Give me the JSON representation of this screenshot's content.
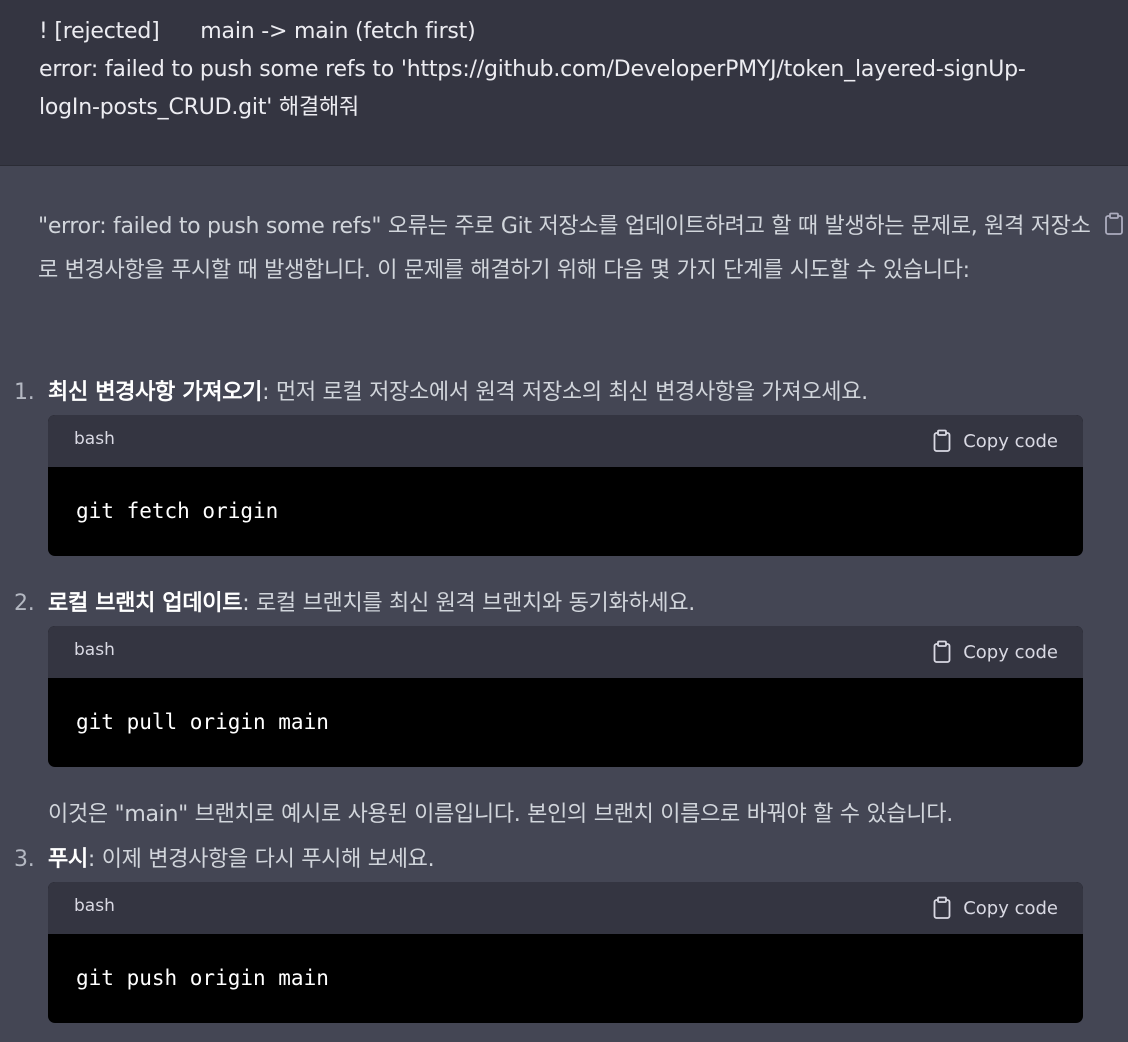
{
  "user": {
    "message": "! [rejected]      main -> main (fetch first)\nerror: failed to push some refs to 'https://github.com/DeveloperPMYJ/token_layered-signUp-\nlogIn-posts_CRUD.git' 해결해줘"
  },
  "assistant": {
    "intro": "\"error: failed to push some refs\" 오류는 주로 Git 저장소를 업데이트하려고 할 때 발생하는 문제로, 원격 저장소로 변경사항을 푸시할 때 발생합니다. 이 문제를 해결하기 위해 다음 몇 가지 단계를 시도할 수 있습니다:",
    "copy_icon": "clipboard-icon",
    "steps": [
      {
        "number": "1.",
        "title": "최신 변경사항 가져오기",
        "text": ": 먼저 로컬 저장소에서 원격 저장소의 최신 변경사항을 가져오세요.",
        "code_lang": "bash",
        "copy_label": "Copy code",
        "code": "git fetch origin"
      },
      {
        "number": "2.",
        "title": "로컬 브랜치 업데이트",
        "text": ": 로컬 브랜치를 최신 원격 브랜치와 동기화하세요.",
        "code_lang": "bash",
        "copy_label": "Copy code",
        "code": "git pull origin main"
      },
      {
        "number": "3.",
        "title": "푸시",
        "text": ": 이제 변경사항을 다시 푸시해 보세요.",
        "code_lang": "bash",
        "copy_label": "Copy code",
        "code": "git push origin main"
      }
    ],
    "note": "이것은 \"main\" 브랜치로 예시로 사용된 이름입니다. 본인의 브랜치 이름으로 바꿔야 할 수 있습니다."
  },
  "colors": {
    "user_bg": "#343541",
    "assistant_bg": "#444654",
    "code_bg": "#000000",
    "code_header_bg": "#343541"
  }
}
